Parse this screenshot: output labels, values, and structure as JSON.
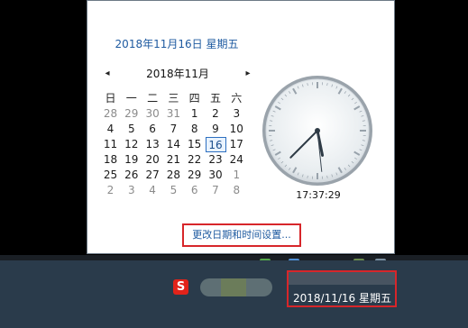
{
  "header": {
    "full_date": "2018年11月16日 星期五"
  },
  "calendar": {
    "month_label": "2018年11月",
    "prev_arrow": "◂",
    "next_arrow": "▸",
    "weekdays": [
      "日",
      "一",
      "二",
      "三",
      "四",
      "五",
      "六"
    ],
    "rows": [
      [
        "28",
        "29",
        "30",
        "31",
        "1",
        "2",
        "3"
      ],
      [
        "4",
        "5",
        "6",
        "7",
        "8",
        "9",
        "10"
      ],
      [
        "11",
        "12",
        "13",
        "14",
        "15",
        "16",
        "17"
      ],
      [
        "18",
        "19",
        "20",
        "21",
        "22",
        "23",
        "24"
      ],
      [
        "25",
        "26",
        "27",
        "28",
        "29",
        "30",
        "1"
      ],
      [
        "2",
        "3",
        "4",
        "5",
        "6",
        "7",
        "8"
      ]
    ],
    "other_month": [
      [
        true,
        true,
        true,
        true,
        false,
        false,
        false
      ],
      [
        false,
        false,
        false,
        false,
        false,
        false,
        false
      ],
      [
        false,
        false,
        false,
        false,
        false,
        false,
        false
      ],
      [
        false,
        false,
        false,
        false,
        false,
        false,
        false
      ],
      [
        false,
        false,
        false,
        false,
        false,
        false,
        true
      ],
      [
        true,
        true,
        true,
        true,
        true,
        true,
        true
      ]
    ],
    "selected_day": "16"
  },
  "clock": {
    "time": "17:37:29"
  },
  "settings_link": {
    "label": "更改日期和时间设置..."
  },
  "taskbar": {
    "sogou_label": "S",
    "tray_date": "2018/11/16 星期五"
  }
}
